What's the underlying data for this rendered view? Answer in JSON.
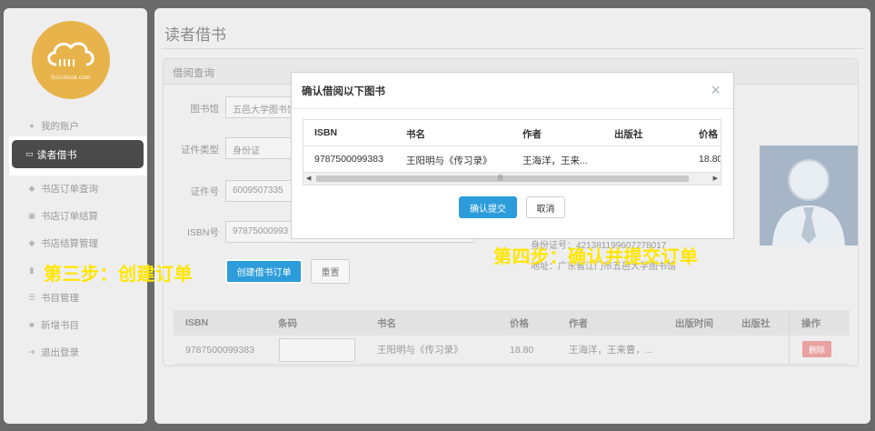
{
  "sidebar": {
    "logo_text": "Sciclloud.com",
    "items": [
      {
        "label": "我的账户",
        "icon": "user-icon"
      },
      {
        "label": "读者借书",
        "icon": "card-icon"
      },
      {
        "label": "书店订单查询",
        "icon": "tag-icon"
      },
      {
        "label": "书店订单结算",
        "icon": "cart-icon"
      },
      {
        "label": "书店结算管理",
        "icon": "tags-icon"
      },
      {
        "label": "书目管理",
        "icon": "list-icon"
      },
      {
        "label": "新增书目",
        "icon": "book-icon"
      },
      {
        "label": "退出登录",
        "icon": "logout-icon"
      }
    ]
  },
  "main": {
    "title": "读者借书",
    "card_header": "借阅查询",
    "form": {
      "library_label": "图书馆",
      "library_value": "五邑大学图书馆",
      "id_type_label": "证件类型",
      "id_type_value": "身份证",
      "id_no_label": "证件号",
      "id_no_value": "6009507335",
      "isbn_label": "ISBN号",
      "isbn_value": "97875000993",
      "create_button": "创建借书订单",
      "reset_button": "重置"
    },
    "reader_info": {
      "line1": "身份证号：421381199607278017",
      "line2": "地址：广东省江门市五邑大学图书馆"
    },
    "table": {
      "headers": [
        "ISBN",
        "条码",
        "书名",
        "价格",
        "作者",
        "出版时间",
        "出版社",
        "操作"
      ],
      "row": {
        "isbn": "9787500099383",
        "title": "王阳明与《传习录》",
        "price": "18.80",
        "author": "王海洋，王来曹，...",
        "delete": "删除"
      }
    }
  },
  "captions": {
    "step3": "第三步：创建订单",
    "step4": "第四步：确认并提交订单"
  },
  "modal": {
    "title": "确认借阅以下图书",
    "close": "×",
    "headers": [
      "ISBN",
      "书名",
      "作者",
      "出版社",
      "价格"
    ],
    "row": {
      "isbn": "9787500099383",
      "title": "王阳明与《传习录》",
      "author": "王海洋，王来...",
      "publisher": "",
      "price": "18.80"
    },
    "confirm_button": "确认提交",
    "cancel_button": "取消"
  },
  "colors": {
    "primary": "#2d9cdb",
    "caption": "#ffe600",
    "logo": "#e8b34a",
    "danger": "#e8a0a0"
  }
}
